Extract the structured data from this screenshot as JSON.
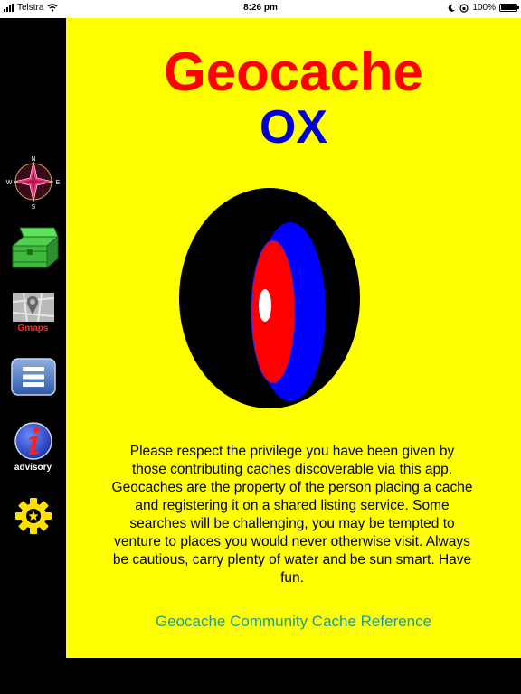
{
  "status_bar": {
    "carrier": "Telstra",
    "time": "8:26 pm",
    "battery": "100%"
  },
  "sidebar": {
    "items": [
      {
        "name": "compass",
        "label": ""
      },
      {
        "name": "treasure-chest",
        "label": ""
      },
      {
        "name": "gmaps",
        "label": "Gmaps"
      },
      {
        "name": "menu",
        "label": ""
      },
      {
        "name": "advisory",
        "label": "advisory"
      },
      {
        "name": "settings",
        "label": ""
      }
    ],
    "compass_letters": {
      "n": "N",
      "s": "S",
      "e": "E",
      "w": "W"
    }
  },
  "main": {
    "title_line1": "Geocache",
    "title_line2": "OX",
    "message": "Please respect the privilege you have been given by those contributing caches discoverable via this app. Geocaches are the property of the person placing a cache and registering it on a shared listing service. Some searches will be challenging, you may be tempted to venture to places you would never otherwise visit. Always be cautious, carry plenty of water and be sun smart. Have fun.",
    "link_text": "Geocache Community Cache Reference"
  },
  "colors": {
    "background": "#ffff00",
    "title_red": "#ff0000",
    "title_blue": "#0000dd",
    "link": "#1b9e8f",
    "sidebar": "#000000"
  }
}
